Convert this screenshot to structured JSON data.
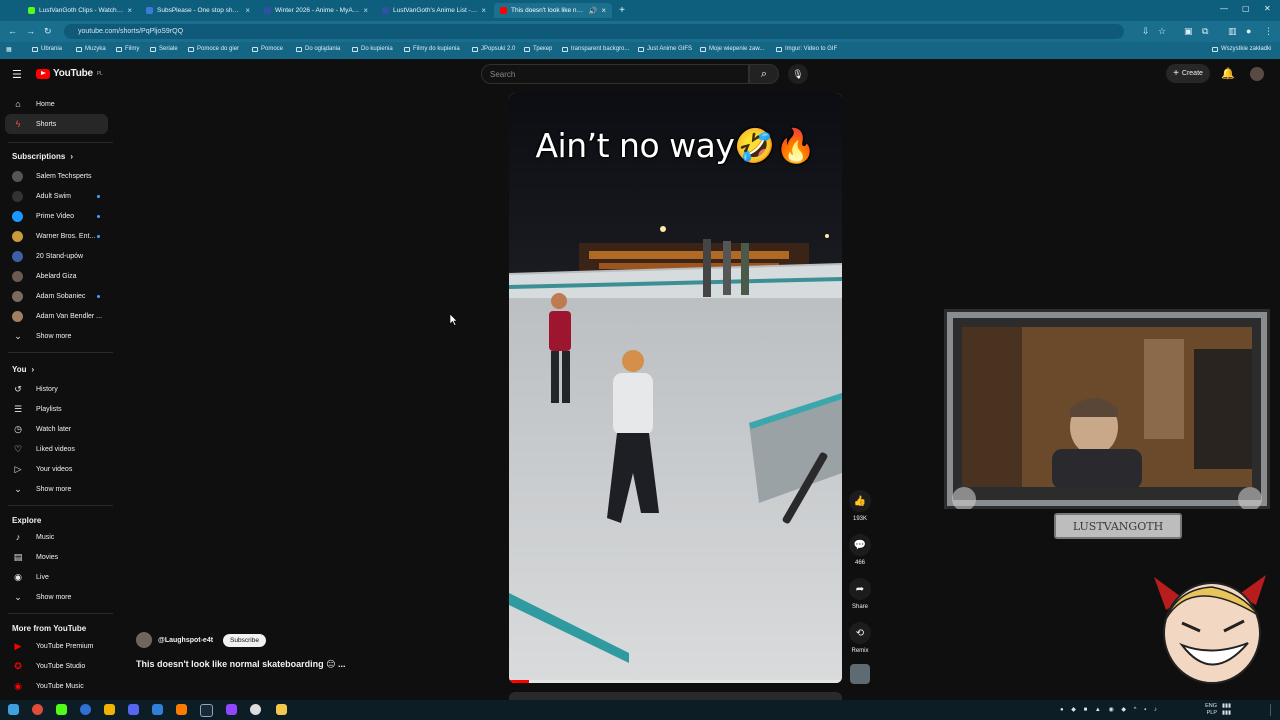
{
  "browser": {
    "tabs": [
      {
        "label": "LustVanGoth Clips - Watch Liv",
        "color": "#53fc18"
      },
      {
        "label": "SubsPlease - One stop shop fo",
        "color": "#3a7bd5"
      },
      {
        "label": "Winter 2026 - Anime - MyAnim",
        "color": "#2e51a2"
      },
      {
        "label": "LustVanGoth's Anime List - My",
        "color": "#2e51a2"
      },
      {
        "label": "This doesn't look like norm",
        "color": "#ff0000"
      }
    ],
    "new_tab": "+",
    "url": "youtube.com/shorts/PqPljoS9rQQ",
    "bookmarks": [
      "Ubrania",
      "Muzyka",
      "Filmy",
      "Seriale",
      "Pomoce do gier",
      "Pomoce",
      "Do oglądania",
      "Do kupienia",
      "Filmy do kupienia",
      "JPopsuki 2.0",
      "Трекер",
      "transparent backgro...",
      "Just Anime GIFS",
      "Moje wiepenie zaw...",
      "Imgur: Video to GIF"
    ],
    "bookmarks_right": "Wszystkie zakładki"
  },
  "header": {
    "logo_text": "YouTube",
    "country": "PL",
    "search_placeholder": "Search",
    "create_label": "Create"
  },
  "sidebar": {
    "main": [
      {
        "label": "Home",
        "icon": "⌂"
      },
      {
        "label": "Shorts",
        "icon": "ϟ"
      }
    ],
    "subscriptions_title": "Subscriptions",
    "subscriptions": [
      {
        "label": "Salem Techsperts",
        "color": "#555",
        "dot": false
      },
      {
        "label": "Adult Swim",
        "color": "#222",
        "dot": true
      },
      {
        "label": "Prime Video",
        "color": "#1a98ff",
        "dot": true
      },
      {
        "label": "Warner Bros. Ent...",
        "color": "#c89b3c",
        "dot": true
      },
      {
        "label": "20 Stand-upów",
        "color": "#3e5ea8",
        "dot": false
      },
      {
        "label": "Abelard Giza",
        "color": "#6b5a52",
        "dot": false
      },
      {
        "label": "Adam Sobaniec",
        "color": "#7a6a60",
        "dot": true
      },
      {
        "label": "Adam Van Bendler ...",
        "color": "#a08060",
        "dot": false
      }
    ],
    "show_more": "Show more",
    "you_title": "You",
    "you": [
      {
        "label": "History",
        "icon": "↺"
      },
      {
        "label": "Playlists",
        "icon": "☰"
      },
      {
        "label": "Watch later",
        "icon": "◷"
      },
      {
        "label": "Liked videos",
        "icon": "♡"
      },
      {
        "label": "Your videos",
        "icon": "▷"
      }
    ],
    "explore_title": "Explore",
    "explore": [
      {
        "label": "Music",
        "icon": "♪"
      },
      {
        "label": "Movies",
        "icon": "▤"
      },
      {
        "label": "Live",
        "icon": "◉"
      }
    ],
    "more_title": "More from YouTube",
    "more": [
      {
        "label": "YouTube Premium",
        "color": "#ff0000"
      },
      {
        "label": "YouTube Studio",
        "color": "#ff0000"
      },
      {
        "label": "YouTube Music",
        "color": "#ff0000"
      }
    ]
  },
  "short": {
    "caption": "Ain’t no way🤣🔥",
    "channel": "@Laughspot-e4t",
    "subscribe_label": "Subscribe",
    "title": "This doesn't look like normal skateboarding 😑 ...",
    "progress": 0.06,
    "actions": [
      {
        "name": "like",
        "icon": "👍",
        "label": "193K"
      },
      {
        "name": "comments",
        "icon": "💬",
        "label": "466"
      },
      {
        "name": "share",
        "icon": "➦",
        "label": "Share"
      },
      {
        "name": "remix",
        "icon": "⟲",
        "label": "Remix"
      }
    ]
  },
  "overlay": {
    "streamer_name": "LUSTVANGOTH"
  },
  "taskbar": {
    "lang": "ENG",
    "locale": "PLP"
  }
}
